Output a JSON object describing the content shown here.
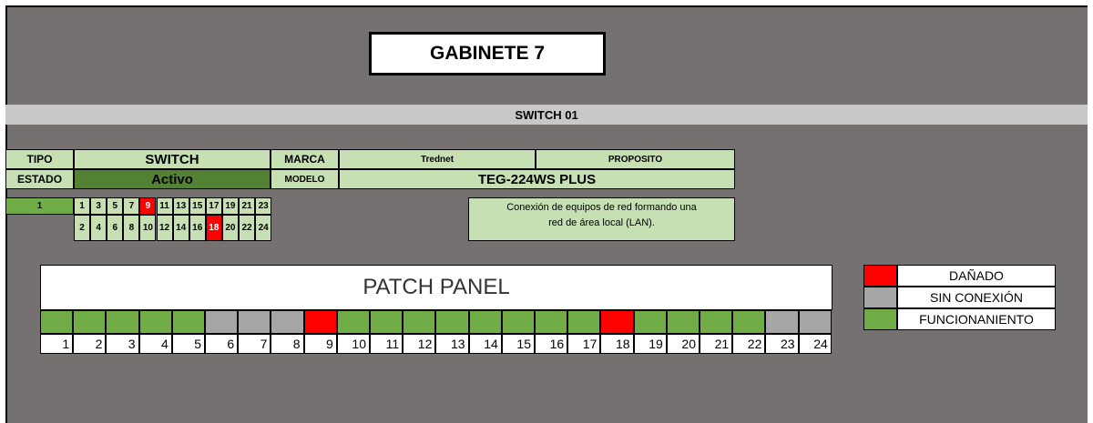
{
  "title": "GABINETE 7",
  "switch_band": "SWITCH 01",
  "table": {
    "tipo_label": "TIPO",
    "tipo_value": "SWITCH",
    "estado_label": "ESTADO",
    "estado_value": "Activo",
    "marca_label": "MARCA",
    "marca_value": "Trednet",
    "modelo_label": "MODELO",
    "modelo_value": "TEG-224WS PLUS",
    "proposito_label": "PROPOSITO",
    "proposito_text_line1": "Conexión de equipos de red formando una",
    "proposito_text_line2": "red de área local (LAN).",
    "switch_number": "1",
    "ports": [
      {
        "num": "1",
        "status": "ok"
      },
      {
        "num": "2",
        "status": "ok"
      },
      {
        "num": "3",
        "status": "ok"
      },
      {
        "num": "4",
        "status": "ok"
      },
      {
        "num": "5",
        "status": "ok"
      },
      {
        "num": "6",
        "status": "ok"
      },
      {
        "num": "7",
        "status": "ok"
      },
      {
        "num": "8",
        "status": "ok"
      },
      {
        "num": "9",
        "status": "damaged"
      },
      {
        "num": "10",
        "status": "ok"
      },
      {
        "num": "11",
        "status": "ok"
      },
      {
        "num": "12",
        "status": "ok"
      },
      {
        "num": "13",
        "status": "ok"
      },
      {
        "num": "14",
        "status": "ok"
      },
      {
        "num": "15",
        "status": "ok"
      },
      {
        "num": "16",
        "status": "ok"
      },
      {
        "num": "17",
        "status": "ok"
      },
      {
        "num": "18",
        "status": "damaged"
      },
      {
        "num": "19",
        "status": "ok"
      },
      {
        "num": "20",
        "status": "ok"
      },
      {
        "num": "21",
        "status": "ok"
      },
      {
        "num": "22",
        "status": "ok"
      },
      {
        "num": "23",
        "status": "ok"
      },
      {
        "num": "24",
        "status": "ok"
      }
    ]
  },
  "patch_panel": {
    "title": "PATCH PANEL",
    "ports": [
      {
        "num": "1",
        "status": "ok"
      },
      {
        "num": "2",
        "status": "ok"
      },
      {
        "num": "3",
        "status": "ok"
      },
      {
        "num": "4",
        "status": "ok"
      },
      {
        "num": "5",
        "status": "ok"
      },
      {
        "num": "6",
        "status": "none"
      },
      {
        "num": "7",
        "status": "none"
      },
      {
        "num": "8",
        "status": "none"
      },
      {
        "num": "9",
        "status": "damaged"
      },
      {
        "num": "10",
        "status": "ok"
      },
      {
        "num": "11",
        "status": "ok"
      },
      {
        "num": "12",
        "status": "ok"
      },
      {
        "num": "13",
        "status": "ok"
      },
      {
        "num": "14",
        "status": "ok"
      },
      {
        "num": "15",
        "status": "ok"
      },
      {
        "num": "16",
        "status": "ok"
      },
      {
        "num": "17",
        "status": "ok"
      },
      {
        "num": "18",
        "status": "damaged"
      },
      {
        "num": "19",
        "status": "ok"
      },
      {
        "num": "20",
        "status": "ok"
      },
      {
        "num": "21",
        "status": "ok"
      },
      {
        "num": "22",
        "status": "ok"
      },
      {
        "num": "23",
        "status": "none"
      },
      {
        "num": "24",
        "status": "none"
      }
    ]
  },
  "legend": [
    {
      "label": "DAÑADO",
      "color": "#ff0000"
    },
    {
      "label": "SIN CONEXIÓN",
      "color": "#a6a6a6"
    },
    {
      "label": "FUNCIONANIENTO",
      "color": "#70ad47"
    }
  ],
  "colors": {
    "background": "#767171",
    "damaged": "#ff0000",
    "no_connection": "#a6a6a6",
    "working": "#70ad47",
    "light_green": "#c6e0b4",
    "dark_green": "#548235"
  }
}
